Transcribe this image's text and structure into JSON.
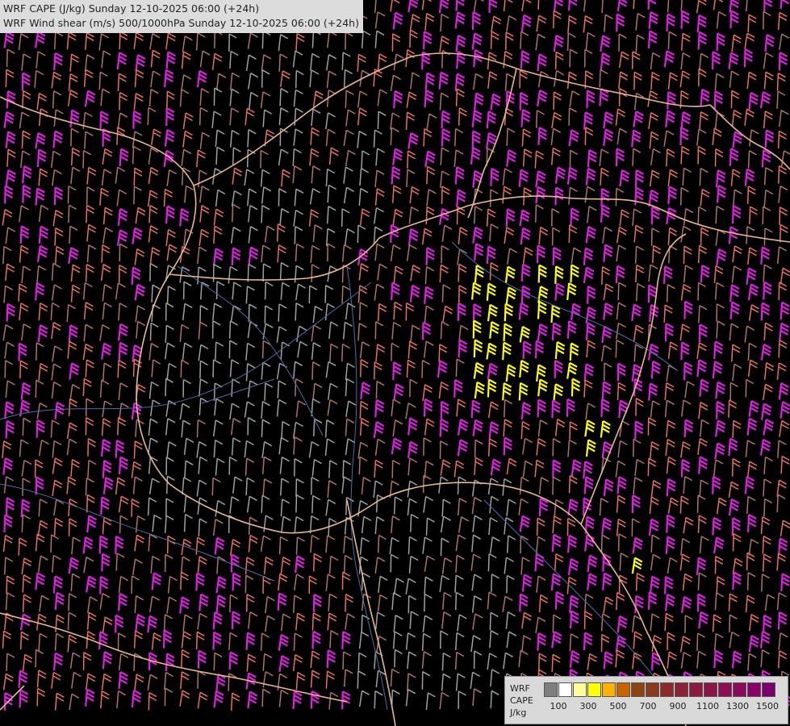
{
  "title": {
    "line1": "WRF CAPE (J/kg) Sunday 12-10-2025 06:00 (+24h)",
    "line2": "WRF Wind shear (m/s) 500/1000hPa Sunday 12-10-2025 06:00 (+24h)"
  },
  "legend": {
    "label_top": "WRF",
    "label_mid": "CAPE",
    "label_unit": "J/kg",
    "colors": [
      "#7f7f7f",
      "#ffffff",
      "#ffff99",
      "#ffff00",
      "#ffb200",
      "#c86400",
      "#8b4513",
      "#8b3a1e",
      "#8b2a2a",
      "#8b2236",
      "#8b1a40",
      "#8b1448",
      "#8b0f52",
      "#8b0a5c",
      "#8b0066",
      "#7a0070"
    ],
    "tick_labels": [
      "100",
      "300",
      "500",
      "700",
      "900",
      "1100",
      "1300",
      "1500"
    ]
  },
  "map": {
    "background": "#000000",
    "border_color": "#e8b890",
    "river_color": "#4a6fa5",
    "barb_colors": [
      "#a0a0a0",
      "#b07070",
      "#e87060",
      "#e020e0",
      "#ffff00"
    ]
  }
}
